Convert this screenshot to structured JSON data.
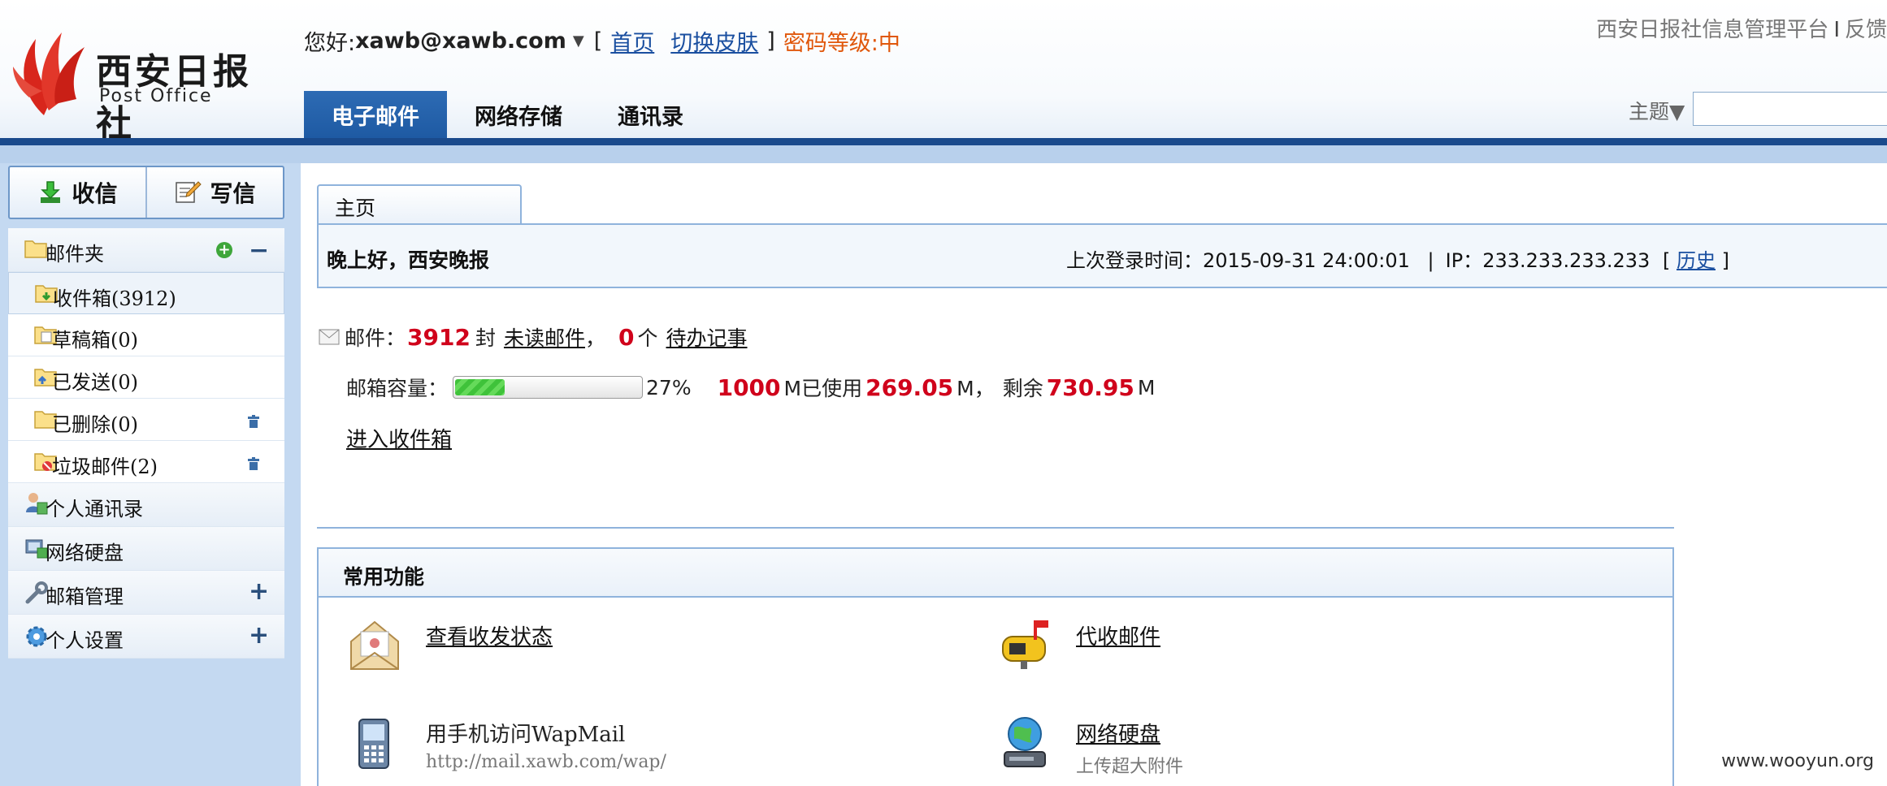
{
  "header": {
    "logo_title": "西安日报社",
    "logo_subtitle": "Post Office",
    "greeting_prefix": "您好:",
    "user_email": "xawb@xawb.com",
    "link_home": "首页",
    "link_skin": "切换皮肤",
    "password_level": "密码等级:中",
    "bracket_open": "[",
    "bracket_close": "]",
    "platform_title": "西安日报社信息管理平台",
    "feedback": "反馈",
    "theme_label": "主题▼",
    "theme_value": ""
  },
  "nav": {
    "tabs": [
      {
        "label": "电子邮件",
        "active": true
      },
      {
        "label": "网络存储",
        "active": false
      },
      {
        "label": "通讯录",
        "active": false
      }
    ]
  },
  "sidebar": {
    "receive_label": "收信",
    "compose_label": "写信",
    "folder_head": "邮件夹",
    "folders": [
      {
        "label": "收件箱(3912)"
      },
      {
        "label": "草稿箱(0)"
      },
      {
        "label": "已发送(0)"
      },
      {
        "label": "已删除(0)"
      },
      {
        "label": "垃圾邮件(2)"
      }
    ],
    "sections": [
      {
        "label": "个人通讯录"
      },
      {
        "label": "网络硬盘"
      },
      {
        "label": "邮箱管理"
      },
      {
        "label": "个人设置"
      }
    ]
  },
  "main": {
    "tab_label": "主页",
    "greeting": "晚上好，西安晚报",
    "last_login_label": "上次登录时间：",
    "last_login_time": "2015-09-31 24:00:01",
    "ip_sep": "|",
    "ip_label": "IP：",
    "ip_value": "233.233.233.233",
    "bracket_open": "[",
    "bracket_close": "]",
    "history_link": "历史",
    "mail_label": "邮件：",
    "mail_count": "3912",
    "mail_unit": "封",
    "unread_link": "未读邮件",
    "comma": "，",
    "todo_count": "0",
    "todo_unit": "个",
    "todo_link": "待办记事",
    "capacity_label": "邮箱容量：",
    "capacity_percent": 27,
    "capacity_percent_text": "27%",
    "capacity_total": "1000",
    "used_text": "M已使用",
    "used_value": "269.05",
    "remain_unit_sep": "M，",
    "remain_label": "剩余",
    "remain_value": "730.95",
    "remain_unit": "M",
    "enter_inbox": "进入收件箱",
    "functions_title": "常用功能",
    "functions": [
      {
        "title": "查看收发状态",
        "sub": ""
      },
      {
        "title": "代收邮件",
        "sub": ""
      },
      {
        "title": "用手机访问WapMail",
        "sub": "http://mail.xawb.com/wap/"
      },
      {
        "title": "网络硬盘",
        "sub": "上传超大附件"
      }
    ]
  },
  "watermark": "www.wooyun.org",
  "colors": {
    "nav_active": "#1e5aa3",
    "header_bar": "#1a4a8c",
    "sidebar_bg": "#c4d9f1",
    "accent_red": "#d0021b",
    "password_orange": "#e0570b",
    "link_blue": "#1a4fa0"
  }
}
